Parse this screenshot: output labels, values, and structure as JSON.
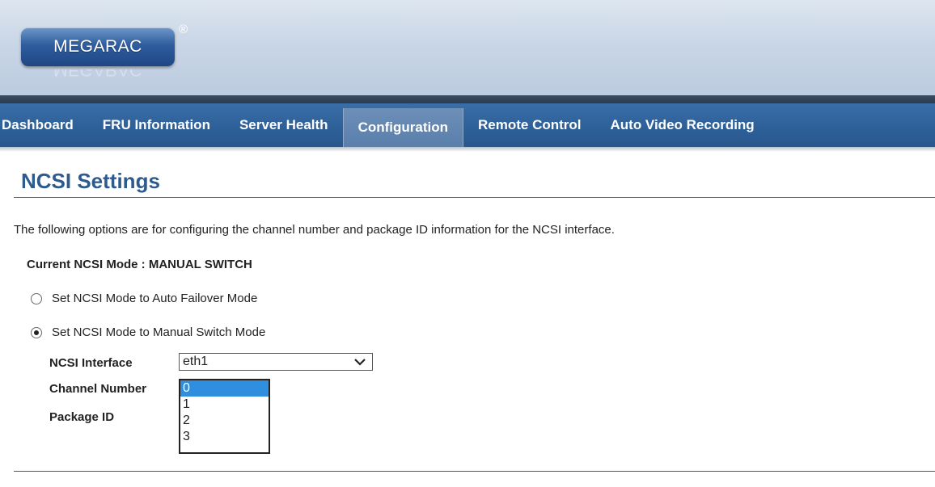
{
  "header": {
    "logo_text": "MEGARAC",
    "registered_mark": "®"
  },
  "nav": {
    "items": [
      {
        "label": "Dashboard"
      },
      {
        "label": "FRU Information"
      },
      {
        "label": "Server Health"
      },
      {
        "label": "Configuration",
        "active": true
      },
      {
        "label": "Remote Control"
      },
      {
        "label": "Auto Video Recording"
      }
    ]
  },
  "page": {
    "title": "NCSI Settings",
    "description": "The following options are for configuring the channel number and package ID information for the NCSI interface.",
    "current_mode": "Current NCSI Mode : MANUAL SWITCH",
    "radio_auto_label": "Set NCSI Mode to Auto Failover Mode",
    "radio_manual_label": "Set NCSI Mode to Manual Switch Mode",
    "radio_selected": "manual",
    "ncsi_interface_label": "NCSI Interface",
    "ncsi_interface_value": "eth1",
    "channel_number_label": "Channel Number",
    "package_id_label": "Package ID",
    "channel_options": [
      "0",
      "1",
      "2",
      "3"
    ],
    "channel_selected": "0"
  },
  "colors": {
    "nav_bg": "#2d5f97",
    "nav_active": "#5a7fac",
    "title": "#2e5b8e",
    "option_highlight": "#2f8ede"
  }
}
